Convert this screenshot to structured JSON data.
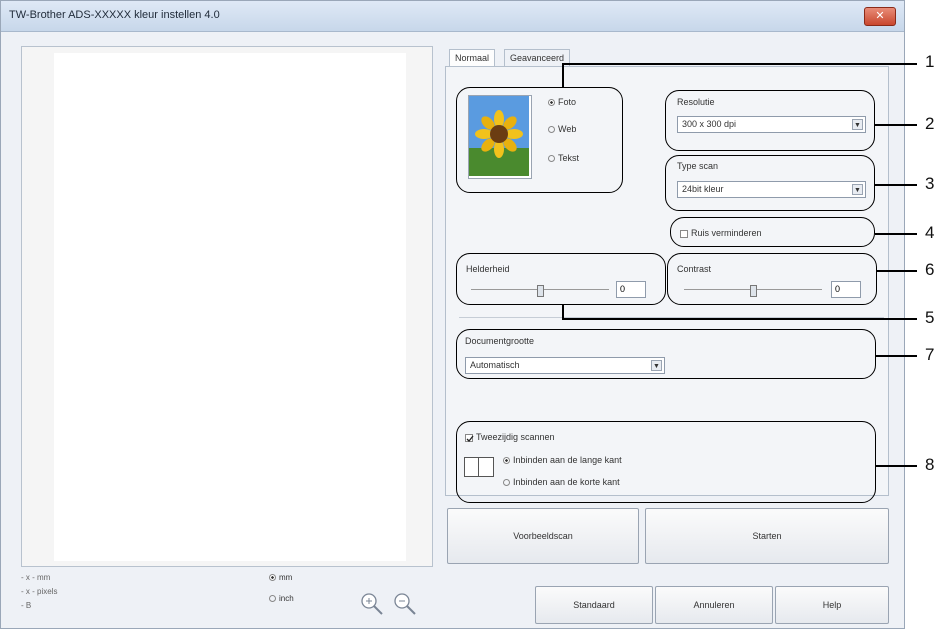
{
  "window": {
    "title": "TW-Brother ADS-XXXXX kleur instellen 4.0",
    "close_glyph": "✕"
  },
  "tabs": [
    {
      "label": "Normaal"
    },
    {
      "label": "Geavanceerd"
    }
  ],
  "image_type": {
    "options": [
      "Foto",
      "Web",
      "Tekst"
    ],
    "selected": "Foto"
  },
  "resolution": {
    "label": "Resolutie",
    "value": "300 x 300 dpi"
  },
  "scan_type": {
    "label": "Type scan",
    "value": "24bit kleur"
  },
  "noise": {
    "label": "Ruis verminderen",
    "checked": false
  },
  "brightness": {
    "label": "Helderheid",
    "value": "0"
  },
  "contrast": {
    "label": "Contrast",
    "value": "0"
  },
  "document_size": {
    "label": "Documentgrootte",
    "value": "Automatisch"
  },
  "duplex": {
    "label": "Tweezijdig scannen",
    "checked": true,
    "long_edge": "Inbinden aan de lange kant",
    "short_edge": "Inbinden aan de korte kant"
  },
  "buttons": {
    "preview": "Voorbeeldscan",
    "start": "Starten",
    "default": "Standaard",
    "cancel": "Annuleren",
    "help": "Help"
  },
  "status": {
    "line1": "- x - mm",
    "line2": "- x - pixels",
    "line3": "- B",
    "unit_mm": "mm",
    "unit_inch": "inch"
  },
  "dropdown_arrow": "▼",
  "callouts": [
    "1",
    "2",
    "3",
    "4",
    "5",
    "6",
    "7",
    "8"
  ]
}
